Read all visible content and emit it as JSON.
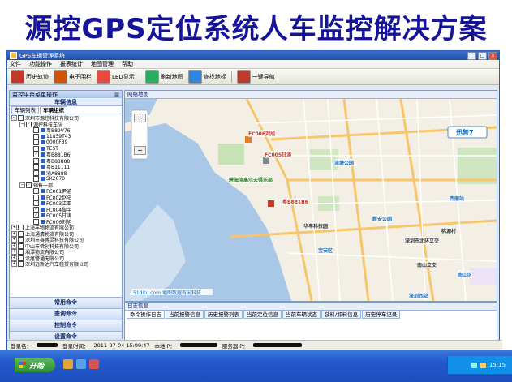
{
  "slide": {
    "title": "源控GPS定位系统人车监控解决方案"
  },
  "window": {
    "title": "GPS车辆管理系统",
    "min": "_",
    "max": "□",
    "close": "x"
  },
  "menu": [
    "文件",
    "功能操作",
    "报表统计",
    "地图管理",
    "帮助"
  ],
  "toolbar": [
    {
      "label": "历史轨迹",
      "icon": "history-track-icon",
      "color": "#c0392b"
    },
    {
      "label": "电子围栏",
      "icon": "e-fence-icon",
      "color": "#d35400"
    },
    {
      "label": "LED显示",
      "icon": "led-icon",
      "color": "#e74c3c"
    },
    {
      "label": "刷新地图",
      "icon": "refresh-icon",
      "color": "#27ae60"
    },
    {
      "label": "查找地标",
      "icon": "find-landmark-icon",
      "color": "#2e86de"
    },
    {
      "label": "一键导航",
      "icon": "navigate-icon",
      "color": "#c0392b"
    }
  ],
  "left_panel": {
    "title": "监控平台菜单操作",
    "pin": "⊠",
    "subtitle": "车辆信息",
    "tabs": [
      "车辆列表",
      "车辆组织"
    ],
    "tree": [
      {
        "indent": 0,
        "exp": "−",
        "cb": false,
        "label": "深圳市源控科技有限公司"
      },
      {
        "indent": 1,
        "exp": "−",
        "cb": true,
        "label": "源控科技车队"
      },
      {
        "indent": 2,
        "exp": "",
        "cb": false,
        "car": true,
        "label": "粤B89V76"
      },
      {
        "indent": 2,
        "exp": "",
        "cb": false,
        "car": true,
        "label": "11859T43"
      },
      {
        "indent": 2,
        "exp": "",
        "cb": false,
        "car": true,
        "label": "0000F39"
      },
      {
        "indent": 2,
        "exp": "",
        "cb": false,
        "car": true,
        "label": "TEST"
      },
      {
        "indent": 2,
        "exp": "",
        "cb": true,
        "car": true,
        "label": "粤B881B6"
      },
      {
        "indent": 2,
        "exp": "",
        "cb": false,
        "car": true,
        "label": "粤B88888"
      },
      {
        "indent": 2,
        "exp": "",
        "cb": false,
        "car": true,
        "label": "粤B11111"
      },
      {
        "indent": 2,
        "exp": "",
        "cb": false,
        "car": true,
        "label": "渝A8888"
      },
      {
        "indent": 2,
        "exp": "",
        "cb": false,
        "car": true,
        "label": "SK2670"
      },
      {
        "indent": 1,
        "exp": "−",
        "cb": true,
        "label": "销售一部"
      },
      {
        "indent": 2,
        "exp": "",
        "cb": false,
        "car": true,
        "label": "FC001尹涵"
      },
      {
        "indent": 2,
        "exp": "",
        "cb": false,
        "car": true,
        "label": "FC002赵阳"
      },
      {
        "indent": 2,
        "exp": "",
        "cb": false,
        "car": true,
        "label": "FC003江亚"
      },
      {
        "indent": 2,
        "exp": "",
        "cb": true,
        "car": true,
        "label": "FC004黎宇"
      },
      {
        "indent": 2,
        "exp": "",
        "cb": true,
        "car": true,
        "label": "FC005甘涛"
      },
      {
        "indent": 2,
        "exp": "",
        "cb": true,
        "car": true,
        "label": "FC006刘旭"
      },
      {
        "indent": 0,
        "exp": "+",
        "cb": false,
        "label": "上海丰物物流有限公司"
      },
      {
        "indent": 0,
        "exp": "+",
        "cb": false,
        "label": "上海通清物流有限公司"
      },
      {
        "indent": 0,
        "exp": "+",
        "cb": false,
        "label": "深圳市赛博灵科技有限公司"
      },
      {
        "indent": 0,
        "exp": "+",
        "cb": false,
        "label": "中山市佛创科技有限公司"
      },
      {
        "indent": 0,
        "exp": "+",
        "cb": false,
        "label": "湘潭物流有限公司"
      },
      {
        "indent": 0,
        "exp": "+",
        "cb": false,
        "label": "沿尾警通无限公司"
      },
      {
        "indent": 0,
        "exp": "+",
        "cb": false,
        "label": "深圳远新达汽车租赁有限公司"
      }
    ],
    "commands": [
      "常用命令",
      "查询命令",
      "控制命令",
      "设置命令"
    ]
  },
  "map": {
    "tab": "网络地图",
    "watermark": "51ditu.com 地图数据有闲科技",
    "brand": "迅普7",
    "labels": [
      {
        "t": "FC006刘旭",
        "c": "#c0392b"
      },
      {
        "t": "FC005甘涛",
        "c": "#c0392b"
      },
      {
        "t": "粤B881B6",
        "c": "#c0392b"
      },
      {
        "t": "流塘公园",
        "c": "#1a6fbf"
      },
      {
        "t": "新安公园",
        "c": "#1a6fbf"
      },
      {
        "t": "宝安区",
        "c": "#1a6fbf"
      },
      {
        "t": "西丽站",
        "c": "#1a6fbf"
      },
      {
        "t": "南山区",
        "c": "#1a6fbf"
      },
      {
        "t": "深圳西站",
        "c": "#1a6fbf"
      },
      {
        "t": "碧海湾高尔夫俱乐部",
        "c": "#2a7f2a"
      },
      {
        "t": "华丰科技园",
        "c": "#333"
      },
      {
        "t": "深圳市北环立交",
        "c": "#333"
      },
      {
        "t": "南山立交",
        "c": "#333"
      },
      {
        "t": "桃源村",
        "c": "#333"
      }
    ]
  },
  "log": {
    "title": "日志信息",
    "tabs": [
      "命令操作日志",
      "当前报警信息",
      "历史报警列表",
      "当前定位信息",
      "当前车辆状态",
      "装料/卸料信息",
      "历史停车记录"
    ]
  },
  "status": {
    "user_label": "登录名：",
    "time_label": "登录时间：",
    "time": "2011-07-04 15:09:47",
    "ip_label": "本地IP：",
    "server_label": "服务器IP："
  },
  "taskbar": {
    "start": "开始",
    "time": "15:15"
  }
}
